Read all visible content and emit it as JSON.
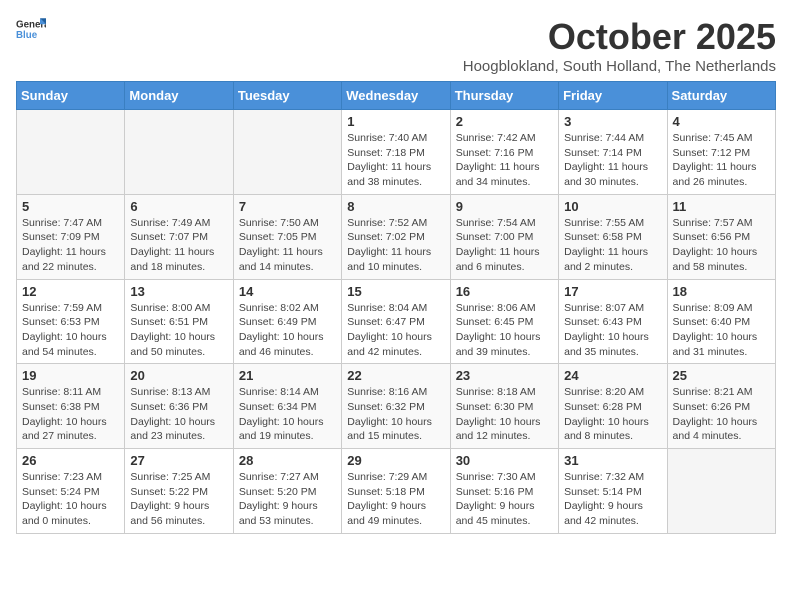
{
  "header": {
    "logo_general": "General",
    "logo_blue": "Blue",
    "month_title": "October 2025",
    "subtitle": "Hoogblokland, South Holland, The Netherlands"
  },
  "weekdays": [
    "Sunday",
    "Monday",
    "Tuesday",
    "Wednesday",
    "Thursday",
    "Friday",
    "Saturday"
  ],
  "weeks": [
    [
      {
        "day": "",
        "info": ""
      },
      {
        "day": "",
        "info": ""
      },
      {
        "day": "",
        "info": ""
      },
      {
        "day": "1",
        "info": "Sunrise: 7:40 AM\nSunset: 7:18 PM\nDaylight: 11 hours\nand 38 minutes."
      },
      {
        "day": "2",
        "info": "Sunrise: 7:42 AM\nSunset: 7:16 PM\nDaylight: 11 hours\nand 34 minutes."
      },
      {
        "day": "3",
        "info": "Sunrise: 7:44 AM\nSunset: 7:14 PM\nDaylight: 11 hours\nand 30 minutes."
      },
      {
        "day": "4",
        "info": "Sunrise: 7:45 AM\nSunset: 7:12 PM\nDaylight: 11 hours\nand 26 minutes."
      }
    ],
    [
      {
        "day": "5",
        "info": "Sunrise: 7:47 AM\nSunset: 7:09 PM\nDaylight: 11 hours\nand 22 minutes."
      },
      {
        "day": "6",
        "info": "Sunrise: 7:49 AM\nSunset: 7:07 PM\nDaylight: 11 hours\nand 18 minutes."
      },
      {
        "day": "7",
        "info": "Sunrise: 7:50 AM\nSunset: 7:05 PM\nDaylight: 11 hours\nand 14 minutes."
      },
      {
        "day": "8",
        "info": "Sunrise: 7:52 AM\nSunset: 7:02 PM\nDaylight: 11 hours\nand 10 minutes."
      },
      {
        "day": "9",
        "info": "Sunrise: 7:54 AM\nSunset: 7:00 PM\nDaylight: 11 hours\nand 6 minutes."
      },
      {
        "day": "10",
        "info": "Sunrise: 7:55 AM\nSunset: 6:58 PM\nDaylight: 11 hours\nand 2 minutes."
      },
      {
        "day": "11",
        "info": "Sunrise: 7:57 AM\nSunset: 6:56 PM\nDaylight: 10 hours\nand 58 minutes."
      }
    ],
    [
      {
        "day": "12",
        "info": "Sunrise: 7:59 AM\nSunset: 6:53 PM\nDaylight: 10 hours\nand 54 minutes."
      },
      {
        "day": "13",
        "info": "Sunrise: 8:00 AM\nSunset: 6:51 PM\nDaylight: 10 hours\nand 50 minutes."
      },
      {
        "day": "14",
        "info": "Sunrise: 8:02 AM\nSunset: 6:49 PM\nDaylight: 10 hours\nand 46 minutes."
      },
      {
        "day": "15",
        "info": "Sunrise: 8:04 AM\nSunset: 6:47 PM\nDaylight: 10 hours\nand 42 minutes."
      },
      {
        "day": "16",
        "info": "Sunrise: 8:06 AM\nSunset: 6:45 PM\nDaylight: 10 hours\nand 39 minutes."
      },
      {
        "day": "17",
        "info": "Sunrise: 8:07 AM\nSunset: 6:43 PM\nDaylight: 10 hours\nand 35 minutes."
      },
      {
        "day": "18",
        "info": "Sunrise: 8:09 AM\nSunset: 6:40 PM\nDaylight: 10 hours\nand 31 minutes."
      }
    ],
    [
      {
        "day": "19",
        "info": "Sunrise: 8:11 AM\nSunset: 6:38 PM\nDaylight: 10 hours\nand 27 minutes."
      },
      {
        "day": "20",
        "info": "Sunrise: 8:13 AM\nSunset: 6:36 PM\nDaylight: 10 hours\nand 23 minutes."
      },
      {
        "day": "21",
        "info": "Sunrise: 8:14 AM\nSunset: 6:34 PM\nDaylight: 10 hours\nand 19 minutes."
      },
      {
        "day": "22",
        "info": "Sunrise: 8:16 AM\nSunset: 6:32 PM\nDaylight: 10 hours\nand 15 minutes."
      },
      {
        "day": "23",
        "info": "Sunrise: 8:18 AM\nSunset: 6:30 PM\nDaylight: 10 hours\nand 12 minutes."
      },
      {
        "day": "24",
        "info": "Sunrise: 8:20 AM\nSunset: 6:28 PM\nDaylight: 10 hours\nand 8 minutes."
      },
      {
        "day": "25",
        "info": "Sunrise: 8:21 AM\nSunset: 6:26 PM\nDaylight: 10 hours\nand 4 minutes."
      }
    ],
    [
      {
        "day": "26",
        "info": "Sunrise: 7:23 AM\nSunset: 5:24 PM\nDaylight: 10 hours\nand 0 minutes."
      },
      {
        "day": "27",
        "info": "Sunrise: 7:25 AM\nSunset: 5:22 PM\nDaylight: 9 hours\nand 56 minutes."
      },
      {
        "day": "28",
        "info": "Sunrise: 7:27 AM\nSunset: 5:20 PM\nDaylight: 9 hours\nand 53 minutes."
      },
      {
        "day": "29",
        "info": "Sunrise: 7:29 AM\nSunset: 5:18 PM\nDaylight: 9 hours\nand 49 minutes."
      },
      {
        "day": "30",
        "info": "Sunrise: 7:30 AM\nSunset: 5:16 PM\nDaylight: 9 hours\nand 45 minutes."
      },
      {
        "day": "31",
        "info": "Sunrise: 7:32 AM\nSunset: 5:14 PM\nDaylight: 9 hours\nand 42 minutes."
      },
      {
        "day": "",
        "info": ""
      }
    ]
  ]
}
